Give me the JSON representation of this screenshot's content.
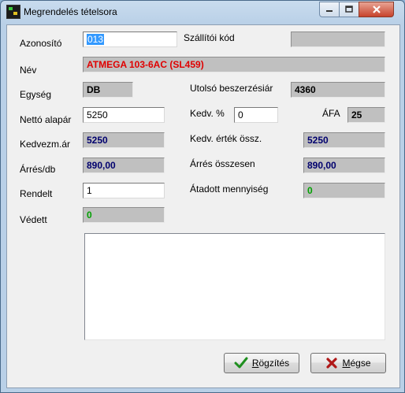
{
  "window": {
    "title": "Megrendelés tételsora",
    "icon": "app-icon",
    "controls": [
      "minimize-icon",
      "maximize-icon",
      "close-icon"
    ]
  },
  "form": {
    "azonosito": {
      "label": "Azonosító",
      "value": "013"
    },
    "szallitoi_kod": {
      "label": "Szállítói kód",
      "value": ""
    },
    "nev": {
      "label": "Név",
      "value": "ATMEGA 103-6AC (SL459)"
    },
    "egyseg": {
      "label": "Egység",
      "value": "DB"
    },
    "utolso_beszerzesi_ar": {
      "label": "Utolsó beszerzésiár",
      "value": "4360"
    },
    "netto_alapar": {
      "label": "Nettó alapár",
      "value": "5250"
    },
    "kedv_szazalek": {
      "label": "Kedv. %",
      "value": "0"
    },
    "afa": {
      "label": "ÁFA",
      "value": "25"
    },
    "kedvezm_ar": {
      "label": "Kedvezm.ár",
      "value": "5250"
    },
    "kedv_ertek_ossz": {
      "label": "Kedv. érték össz.",
      "value": "5250"
    },
    "arres_db": {
      "label": "Árrés/db",
      "value": "890,00"
    },
    "arres_osszesen": {
      "label": "Árrés összesen",
      "value": "890,00"
    },
    "rendelt": {
      "label": "Rendelt",
      "value": "1"
    },
    "atadott_mennyiseg": {
      "label": "Átadott mennyiség",
      "value": "0"
    },
    "vedett": {
      "label": "Védett",
      "value": "0"
    },
    "megjegyzes": {
      "value": ""
    }
  },
  "buttons": {
    "rogzites": {
      "label_underlined": "R",
      "label_rest": "ögzítés",
      "icon": "checkmark-icon"
    },
    "megse": {
      "label_underlined": "M",
      "label_rest": "égse",
      "icon": "x-icon"
    }
  },
  "colors": {
    "name_text": "#e00000",
    "computed_text": "#00006e",
    "quantity_text": "#00a000",
    "selection": "#3399ff"
  }
}
